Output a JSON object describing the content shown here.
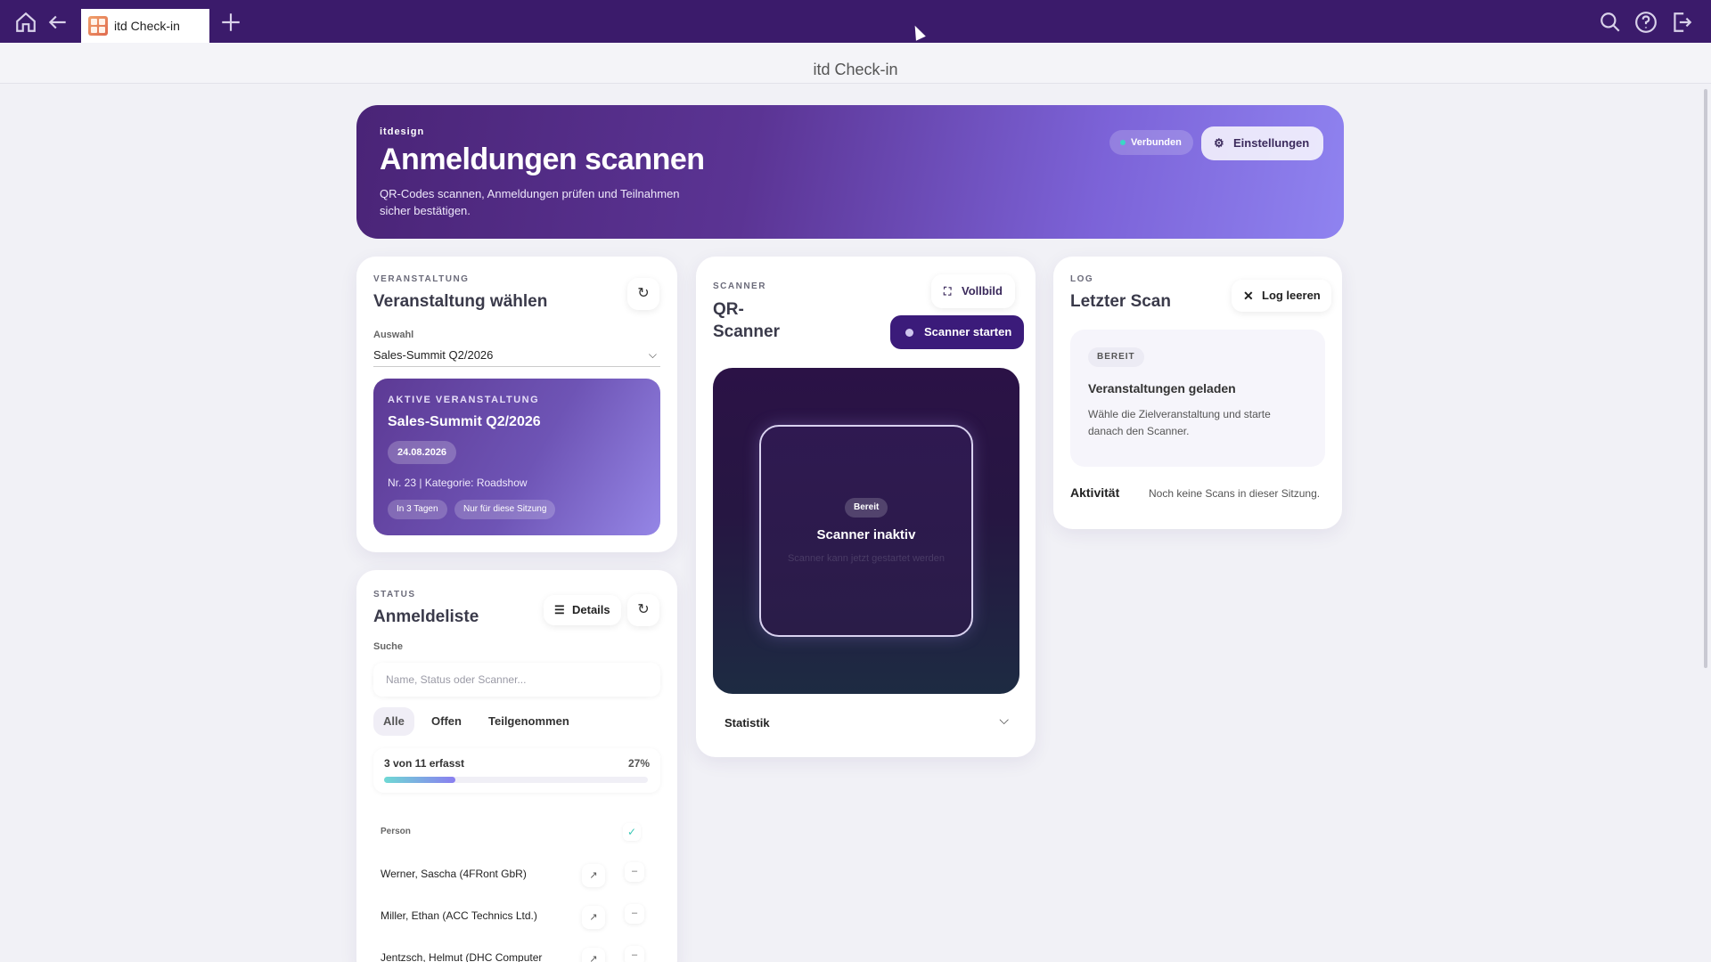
{
  "browser": {
    "tab_title": "itd Check-in",
    "icons": [
      "home-icon",
      "back-arrow-icon",
      "new-tab-plus-icon",
      "search-icon",
      "help-icon",
      "exit-icon"
    ]
  },
  "app": {
    "title": "itd Check-in"
  },
  "hero": {
    "brand": "itdesign",
    "title": "Anmeldungen scannen",
    "subtitle": "QR-Codes scannen, Anmeldungen prüfen und Teilnahmen sicher bestätigen.",
    "connection_status": "Verbunden",
    "settings_label": "Einstellungen",
    "settings_icon": "gear-icon"
  },
  "event_card": {
    "section_label": "VERANSTALTUNG",
    "title": "Veranstaltung wählen",
    "refresh_icon": "↻",
    "select_label": "Auswahl",
    "selected": "Sales-Summit Q2/2026",
    "active": {
      "label": "AKTIVE VERANSTALTUNG",
      "name": "Sales-Summit Q2/2026",
      "date": "24.08.2026",
      "meta": "Nr. 23 | Kategorie: Roadshow",
      "chips": [
        "In 3 Tagen",
        "Nur für diese Sitzung"
      ]
    }
  },
  "status_card": {
    "section_label": "STATUS",
    "title": "Anmeldeliste",
    "details_label": "Details",
    "refresh_icon": "↻",
    "search_label": "Suche",
    "search_placeholder": "Name, Status oder Scanner...",
    "filters": [
      "Alle",
      "Offen",
      "Teilgenommen"
    ],
    "progress_text": "3 von 11 erfasst",
    "progress_percent": "27%",
    "progress_fraction": 0.27,
    "list_header": "Person",
    "check_icon": "✓",
    "people": [
      {
        "name": "Werner, Sascha (4FRont GbR)",
        "action": "↗",
        "mark": "–"
      },
      {
        "name": "Miller, Ethan (ACC Technics Ltd.)",
        "action": "↗",
        "mark": "–"
      },
      {
        "name": "Jentzsch, Helmut (DHC Computer",
        "action": "↗",
        "mark": "–"
      }
    ]
  },
  "scanner_card": {
    "section_label": "SCANNER",
    "title_line1": "QR-",
    "title_line2": "Scanner",
    "fullscreen_label": "Vollbild",
    "start_label": "Scanner starten",
    "ready_badge": "Bereit",
    "inactive_title": "Scanner inaktiv",
    "inactive_hint": "Scanner kann jetzt gestartet werden",
    "stats_label": "Statistik"
  },
  "log_card": {
    "section_label": "LOG",
    "title": "Letzter Scan",
    "clear_label": "Log leeren",
    "badge": "BEREIT",
    "heading": "Veranstaltungen geladen",
    "description": "Wähle die Zielveranstaltung und starte danach den Scanner.",
    "activity_label": "Aktivität",
    "activity_value": "Noch keine Scans in dieser Sitzung."
  },
  "colors": {
    "topbar": "#3b1b6b",
    "accent": "#3b1b7a",
    "connected_dot": "#3bd6c6"
  }
}
